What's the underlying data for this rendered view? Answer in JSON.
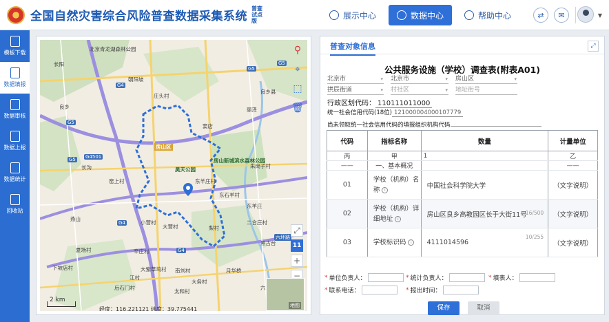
{
  "header": {
    "title": "全国自然灾害综合风险普查数据采集系统",
    "badge": "普查 试点版",
    "nav": [
      {
        "label": "展示中心",
        "active": false
      },
      {
        "label": "数据中心",
        "active": true
      },
      {
        "label": "帮助中心",
        "active": false
      }
    ]
  },
  "sidebar": {
    "items": [
      {
        "label": "模板下载",
        "active": false
      },
      {
        "label": "数据填报",
        "active": true
      },
      {
        "label": "数据审核",
        "active": false
      },
      {
        "label": "数据上报",
        "active": false
      },
      {
        "label": "数据统计",
        "active": false
      },
      {
        "label": "回收站",
        "active": false
      }
    ]
  },
  "map": {
    "labels": [
      "北京青龙湖森林公园",
      "长阳",
      "朝阳坡",
      "庄头村",
      "丽泽",
      "良乡",
      "房山区",
      "昊天公园",
      "东羊庄村",
      "小营村",
      "大营村",
      "燕山",
      "窦店",
      "辛庄村",
      "大紫草坞村",
      "东石羊村",
      "南刘村",
      "夏场村",
      "下坡店村",
      "后石门村",
      "太和村",
      "梨村",
      "月华桥",
      "大务村",
      "房山新城滨水森林公园",
      "朱岗子村",
      "江村",
      "二合庄村",
      "黑古台",
      "六环路",
      "东羊庄",
      "窑上村",
      "长沟",
      "良乡县"
    ],
    "road_labels": [
      "G5",
      "G5",
      "G4501",
      "G4",
      "G4",
      "G4",
      "G5",
      "G5",
      "六环路"
    ],
    "zoom_level": "11",
    "scale": "2 km",
    "coordinates": "经度：116.221121  纬度：39.775441",
    "thumb_label": "地图"
  },
  "form": {
    "tab": "普查对象信息",
    "title": "公共服务设施（学校）调查表(附表A01)",
    "selects_row1": [
      "北京市",
      "北京市",
      "房山区"
    ],
    "selects_row2": [
      "拱辰街道",
      "村社区",
      "地址街号"
    ],
    "admin_code_label": "行政区划代码：",
    "admin_code_value": "110111011000",
    "credit_code_label": "统一社会信用代码(18位)",
    "credit_code_value": "121000004000107779",
    "org_code_label": "尚未领取统一社会信用代码的填报组织机构代码",
    "org_code_value": "",
    "columns": [
      "代码",
      "指标名称",
      "数量",
      "计量单位"
    ],
    "sub_header": [
      "丙",
      "甲",
      "1",
      "乙"
    ],
    "section": {
      "code": "——",
      "name": "一、基本概况",
      "unit": "——"
    },
    "rows": [
      {
        "code": "01",
        "name": "学校（机构）名称",
        "value": "中国社会科学院大学",
        "counter": "",
        "unit": "（文字说明）"
      },
      {
        "code": "02",
        "name": "学校（机构）详细地址",
        "value": "房山区良乡高教园区长于大街11号",
        "counter": "16/500",
        "unit": "（文字说明）"
      },
      {
        "code": "03",
        "name": "学校标识码",
        "value": "4111014596",
        "counter": "10/255",
        "unit": "（文字说明）"
      }
    ],
    "footer": {
      "leader_label": "单位负责人：",
      "stat_leader_label": "统计负责人：",
      "filler_label": "填表人：",
      "phone_label": "联系电话：",
      "date_label": "报出时间："
    },
    "save_label": "保存",
    "cancel_label": "取消"
  }
}
